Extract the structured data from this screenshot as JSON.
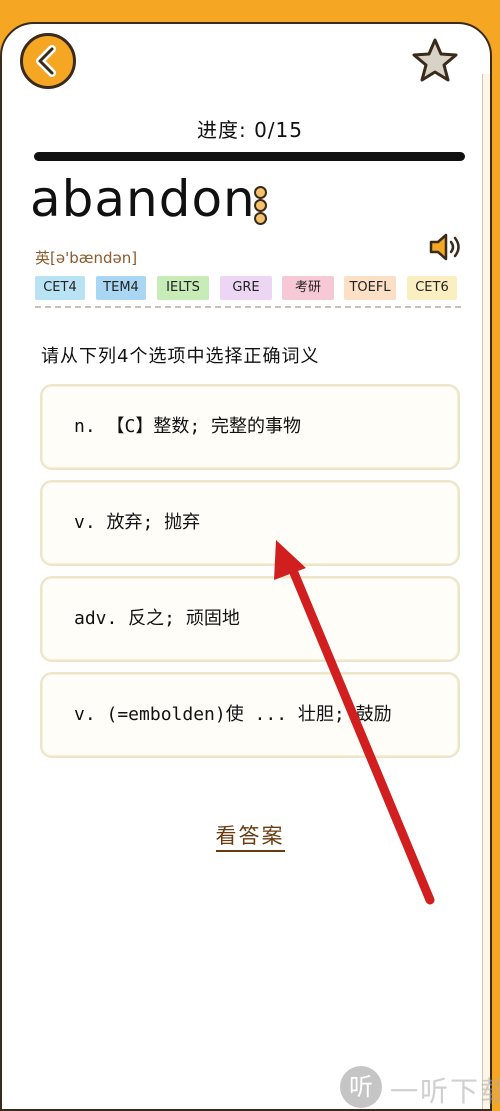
{
  "header": {
    "progress_text": "进度: 0/15",
    "progress_fraction": 0
  },
  "word": {
    "text": "abandon",
    "phonetic": "英[ə'bændən]"
  },
  "icons": {
    "back": "chevron-left-icon",
    "favorite": "star-icon",
    "more": "more-dots-icon",
    "speaker": "speaker-icon"
  },
  "tags": [
    {
      "label": "CET4",
      "color": "#b9e3f4"
    },
    {
      "label": "TEM4",
      "color": "#a9d6f2"
    },
    {
      "label": "IELTS",
      "color": "#c8ecb8"
    },
    {
      "label": "GRE",
      "color": "#ecd6f3"
    },
    {
      "label": "考研",
      "color": "#f7c8d6"
    },
    {
      "label": "TOEFL",
      "color": "#fbe0c6"
    },
    {
      "label": "CET6",
      "color": "#fbeec0"
    }
  ],
  "quiz": {
    "instruction": "请从下列4个选项中选择正确词义",
    "options": [
      "n. 【C】整数; 完整的事物",
      "v. 放弃; 抛弃",
      "adv. 反之; 顽固地",
      "v. (=embolden)使 ... 壮胆; 鼓励"
    ],
    "show_answer": "看答案"
  },
  "watermark": {
    "icon_char": "听",
    "text": "一听下载"
  },
  "colors": {
    "accent": "#f5a623",
    "annotation_arrow": "#d11f1f"
  }
}
